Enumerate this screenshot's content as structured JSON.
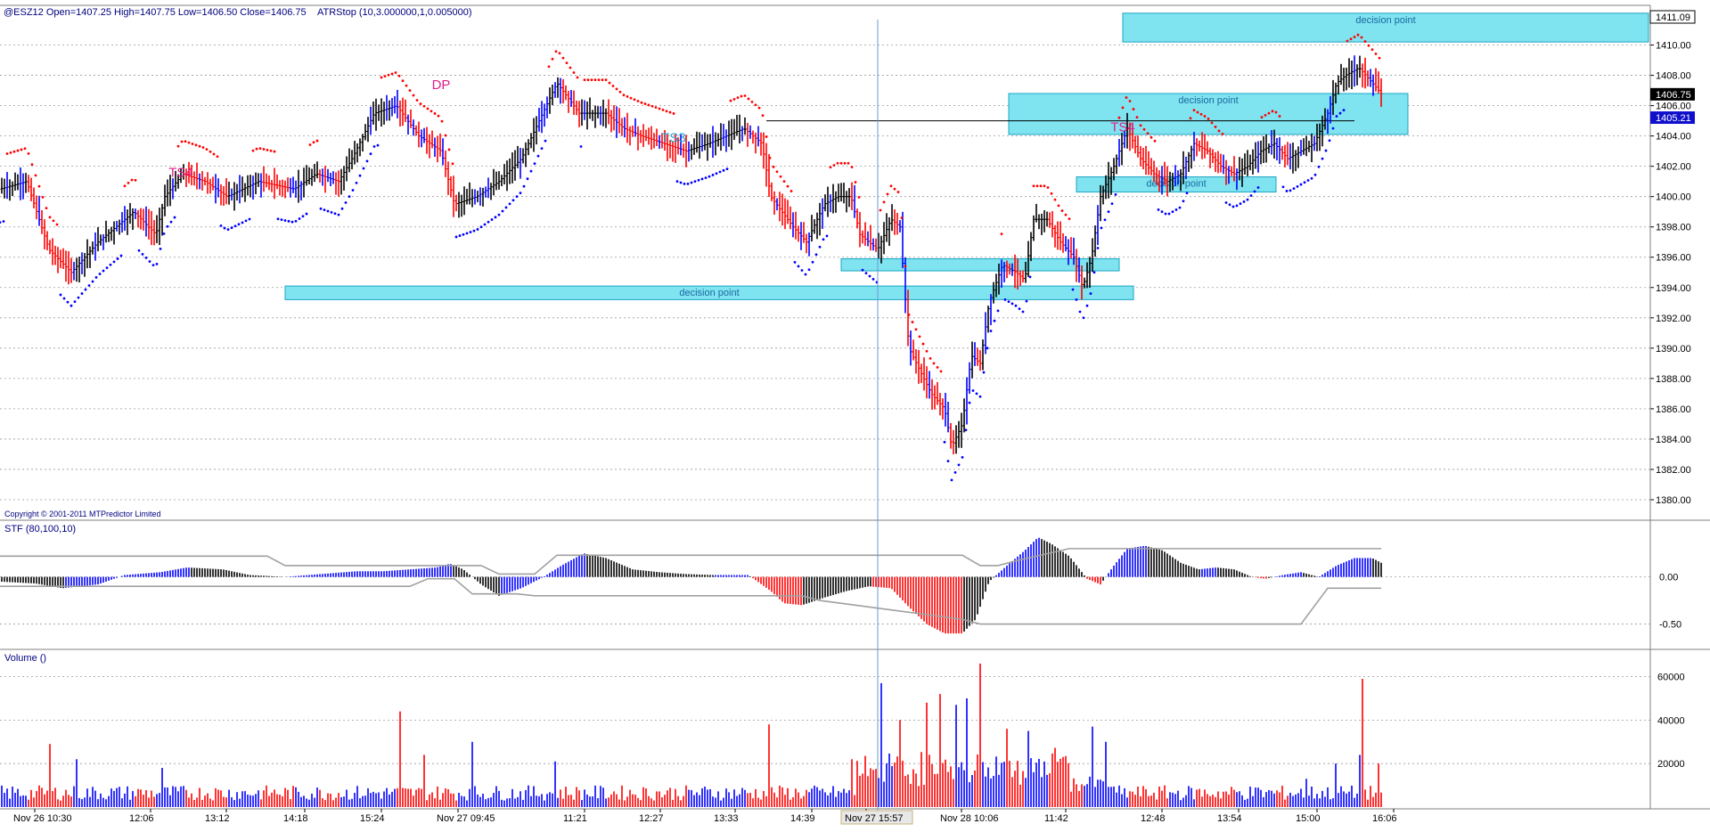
{
  "header": {
    "symbol_line": "@ESZ12  Open=1407.25  High=1407.75  Low=1406.50  Close=1406.75",
    "indicator": "ATRStop (10,3.000000,1,0.005000)",
    "copyright": "Copyright © 2001-2011 MTPredictor Limited"
  },
  "panels": {
    "stf_label": "STF (80,100,10)",
    "volume_label": "Volume ()"
  },
  "price_badges": {
    "top": "1411.09",
    "close": "1406.75",
    "stop": "1405.21"
  },
  "colors": {
    "up_bar": "#000000",
    "down_bar": "#ff0000",
    "blue": "#0000ff",
    "zone_fill": "#7fe3f0",
    "zone_border": "#1ba6c4",
    "grid": "#9a9a9a",
    "cursor": "#6b9bd6",
    "label_pink": "#e0208a",
    "label_cyan": "#2aa8d8"
  },
  "chart_data": [
    {
      "type": "candlestick",
      "name": "price",
      "ylim": [
        1379,
        1412.5
      ],
      "yticks": [
        1380,
        1382,
        1384,
        1386,
        1388,
        1390,
        1392,
        1394,
        1396,
        1398,
        1400,
        1402,
        1404,
        1406,
        1408,
        1410
      ],
      "x_labels": [
        "Nov 26 10:30",
        "12:06",
        "13:12",
        "14:18",
        "15:24",
        "Nov 27 09:45",
        "11:21",
        "12:27",
        "13:33",
        "14:39",
        "Nov 27 15:57",
        "Nov 28 10:06",
        "11:42",
        "12:48",
        "13:54",
        "15:00",
        "16:06"
      ],
      "path": [
        [
          0,
          1400.5
        ],
        [
          30,
          1401
        ],
        [
          55,
          1396.5
        ],
        [
          80,
          1395
        ],
        [
          110,
          1397
        ],
        [
          150,
          1399
        ],
        [
          175,
          1397.5
        ],
        [
          185,
          1400
        ],
        [
          205,
          1401.5
        ],
        [
          230,
          1401
        ],
        [
          255,
          1400
        ],
        [
          290,
          1401
        ],
        [
          330,
          1400.5
        ],
        [
          355,
          1401.5
        ],
        [
          380,
          1401
        ],
        [
          395,
          1402.5
        ],
        [
          420,
          1405.5
        ],
        [
          445,
          1406
        ],
        [
          470,
          1404
        ],
        [
          495,
          1403
        ],
        [
          510,
          1399.5
        ],
        [
          535,
          1400
        ],
        [
          560,
          1401
        ],
        [
          585,
          1402.5
        ],
        [
          605,
          1405
        ],
        [
          625,
          1407.5
        ],
        [
          650,
          1405.5
        ],
        [
          680,
          1405.5
        ],
        [
          700,
          1404.5
        ],
        [
          720,
          1404
        ],
        [
          745,
          1403.5
        ],
        [
          770,
          1403
        ],
        [
          795,
          1403.5
        ],
        [
          835,
          1404.5
        ],
        [
          855,
          1403.5
        ],
        [
          865,
          1400
        ],
        [
          890,
          1398
        ],
        [
          905,
          1397
        ],
        [
          925,
          1399.5
        ],
        [
          940,
          1400
        ],
        [
          955,
          1400
        ],
        [
          965,
          1397.5
        ],
        [
          985,
          1396.5
        ],
        [
          1000,
          1398.5
        ],
        [
          1010,
          1398
        ],
        [
          1020,
          1390
        ],
        [
          1045,
          1387
        ],
        [
          1060,
          1386
        ],
        [
          1068,
          1383.5
        ],
        [
          1080,
          1385
        ],
        [
          1090,
          1389.5
        ],
        [
          1100,
          1389
        ],
        [
          1110,
          1393
        ],
        [
          1125,
          1395.5
        ],
        [
          1140,
          1395
        ],
        [
          1150,
          1394.5
        ],
        [
          1160,
          1398.5
        ],
        [
          1175,
          1398.5
        ],
        [
          1190,
          1397
        ],
        [
          1205,
          1396
        ],
        [
          1215,
          1394
        ],
        [
          1225,
          1396
        ],
        [
          1235,
          1400
        ],
        [
          1250,
          1402
        ],
        [
          1265,
          1404.5
        ],
        [
          1280,
          1402.5
        ],
        [
          1295,
          1401.5
        ],
        [
          1310,
          1401
        ],
        [
          1325,
          1401.5
        ],
        [
          1340,
          1403.5
        ],
        [
          1355,
          1403
        ],
        [
          1370,
          1402
        ],
        [
          1385,
          1401.5
        ],
        [
          1400,
          1402
        ],
        [
          1415,
          1403
        ],
        [
          1430,
          1403.5
        ],
        [
          1445,
          1402.5
        ],
        [
          1460,
          1403
        ],
        [
          1475,
          1403.5
        ],
        [
          1490,
          1405.5
        ],
        [
          1500,
          1407.5
        ],
        [
          1510,
          1408
        ],
        [
          1525,
          1408.5
        ],
        [
          1540,
          1407.5
        ],
        [
          1550,
          1406.8
        ]
      ],
      "annotations": [
        {
          "text": "TS4",
          "x": 203,
          "y": 1401.3
        },
        {
          "text": "DP",
          "x": 495,
          "y": 1407.1
        },
        {
          "text": "TS3",
          "x": 756,
          "y": 1403.6
        },
        {
          "text": "TS4",
          "x": 1260,
          "y": 1404.3
        }
      ],
      "zones": [
        {
          "label": "decision point",
          "x0": 320,
          "x1": 1272,
          "y0": 1393.2,
          "y1": 1394.1,
          "show_label": true
        },
        {
          "label": "",
          "x0": 944,
          "x1": 1256,
          "y0": 1395.1,
          "y1": 1395.9,
          "show_label": false
        },
        {
          "label": "decision point",
          "x0": 1132,
          "x1": 1580,
          "y0": 1404.1,
          "y1": 1406.8,
          "show_label": true
        },
        {
          "label": "decision point",
          "x0": 1208,
          "x1": 1432,
          "y0": 1400.3,
          "y1": 1401.3,
          "show_label": true
        },
        {
          "label": "decision point",
          "x0": 1260,
          "x1": 1850,
          "y0": 1410.2,
          "y1": 1412.1,
          "show_label": true
        }
      ],
      "horizontal_line": {
        "y": 1405,
        "x0": 860,
        "x1": 1520
      }
    },
    {
      "type": "bar",
      "name": "STF (80,100,10)",
      "ylim": [
        -0.75,
        0.45
      ],
      "yticks": [
        0.0,
        -0.5
      ],
      "ytick_labels": [
        "0.00",
        "-0.50"
      ],
      "path": [
        [
          0,
          -0.05
        ],
        [
          40,
          -0.07
        ],
        [
          70,
          -0.12
        ],
        [
          110,
          -0.08
        ],
        [
          140,
          0.02
        ],
        [
          180,
          0.05
        ],
        [
          210,
          0.1
        ],
        [
          250,
          0.08
        ],
        [
          280,
          0.02
        ],
        [
          320,
          0.0
        ],
        [
          360,
          0.03
        ],
        [
          400,
          0.06
        ],
        [
          430,
          0.06
        ],
        [
          460,
          0.08
        ],
        [
          490,
          0.1
        ],
        [
          505,
          0.14
        ],
        [
          520,
          0.08
        ],
        [
          540,
          -0.08
        ],
        [
          560,
          -0.2
        ],
        [
          585,
          -0.12
        ],
        [
          610,
          0.0
        ],
        [
          630,
          0.12
        ],
        [
          655,
          0.25
        ],
        [
          680,
          0.2
        ],
        [
          710,
          0.08
        ],
        [
          740,
          0.05
        ],
        [
          770,
          0.03
        ],
        [
          800,
          0.02
        ],
        [
          840,
          0.02
        ],
        [
          865,
          -0.15
        ],
        [
          880,
          -0.28
        ],
        [
          900,
          -0.3
        ],
        [
          925,
          -0.22
        ],
        [
          950,
          -0.15
        ],
        [
          975,
          -0.1
        ],
        [
          1000,
          -0.12
        ],
        [
          1020,
          -0.32
        ],
        [
          1040,
          -0.5
        ],
        [
          1060,
          -0.6
        ],
        [
          1080,
          -0.6
        ],
        [
          1095,
          -0.45
        ],
        [
          1110,
          -0.05
        ],
        [
          1130,
          0.12
        ],
        [
          1150,
          0.28
        ],
        [
          1165,
          0.42
        ],
        [
          1180,
          0.35
        ],
        [
          1200,
          0.22
        ],
        [
          1220,
          -0.02
        ],
        [
          1235,
          -0.08
        ],
        [
          1250,
          0.12
        ],
        [
          1265,
          0.3
        ],
        [
          1285,
          0.33
        ],
        [
          1305,
          0.28
        ],
        [
          1325,
          0.15
        ],
        [
          1345,
          0.08
        ],
        [
          1365,
          0.1
        ],
        [
          1385,
          0.08
        ],
        [
          1405,
          0.0
        ],
        [
          1420,
          -0.02
        ],
        [
          1440,
          0.02
        ],
        [
          1460,
          0.05
        ],
        [
          1480,
          0.0
        ],
        [
          1500,
          0.12
        ],
        [
          1520,
          0.2
        ],
        [
          1540,
          0.2
        ],
        [
          1550,
          0.15
        ]
      ],
      "upper_band": [
        [
          0,
          0.22
        ],
        [
          300,
          0.22
        ],
        [
          320,
          0.12
        ],
        [
          540,
          0.12
        ],
        [
          560,
          0.03
        ],
        [
          600,
          0.03
        ],
        [
          625,
          0.23
        ],
        [
          1080,
          0.23
        ],
        [
          1100,
          0.12
        ],
        [
          1120,
          0.12
        ],
        [
          1140,
          0.17
        ],
        [
          1200,
          0.3
        ],
        [
          1550,
          0.3
        ]
      ],
      "lower_band": [
        [
          0,
          -0.1
        ],
        [
          460,
          -0.1
        ],
        [
          480,
          -0.02
        ],
        [
          510,
          -0.02
        ],
        [
          530,
          -0.18
        ],
        [
          580,
          -0.18
        ],
        [
          600,
          -0.2
        ],
        [
          900,
          -0.2
        ],
        [
          920,
          -0.25
        ],
        [
          1080,
          -0.45
        ],
        [
          1100,
          -0.5
        ],
        [
          1460,
          -0.5
        ],
        [
          1490,
          -0.12
        ],
        [
          1550,
          -0.12
        ]
      ]
    },
    {
      "type": "bar",
      "name": "Volume ()",
      "ylim": [
        0,
        68000
      ],
      "yticks": [
        20000,
        40000,
        60000
      ],
      "ytick_labels": [
        "20000",
        "40000",
        "60000"
      ],
      "peaks": [
        {
          "x": 57,
          "v": 29000
        },
        {
          "x": 86,
          "v": 22000
        },
        {
          "x": 183,
          "v": 18000
        },
        {
          "x": 448,
          "v": 44000
        },
        {
          "x": 475,
          "v": 24000
        },
        {
          "x": 530,
          "v": 30000
        },
        {
          "x": 622,
          "v": 21000
        },
        {
          "x": 862,
          "v": 38000
        },
        {
          "x": 955,
          "v": 22000
        },
        {
          "x": 988,
          "v": 57000
        },
        {
          "x": 1010,
          "v": 40000
        },
        {
          "x": 1040,
          "v": 48000
        },
        {
          "x": 1055,
          "v": 52000
        },
        {
          "x": 1073,
          "v": 47000
        },
        {
          "x": 1085,
          "v": 50000
        },
        {
          "x": 1100,
          "v": 66000
        },
        {
          "x": 1130,
          "v": 36000
        },
        {
          "x": 1155,
          "v": 35000
        },
        {
          "x": 1225,
          "v": 37000
        },
        {
          "x": 1240,
          "v": 30000
        },
        {
          "x": 1465,
          "v": 13000
        },
        {
          "x": 1500,
          "v": 20000
        },
        {
          "x": 1525,
          "v": 24000
        },
        {
          "x": 1528,
          "v": 59000
        },
        {
          "x": 1548,
          "v": 20000
        }
      ]
    }
  ]
}
